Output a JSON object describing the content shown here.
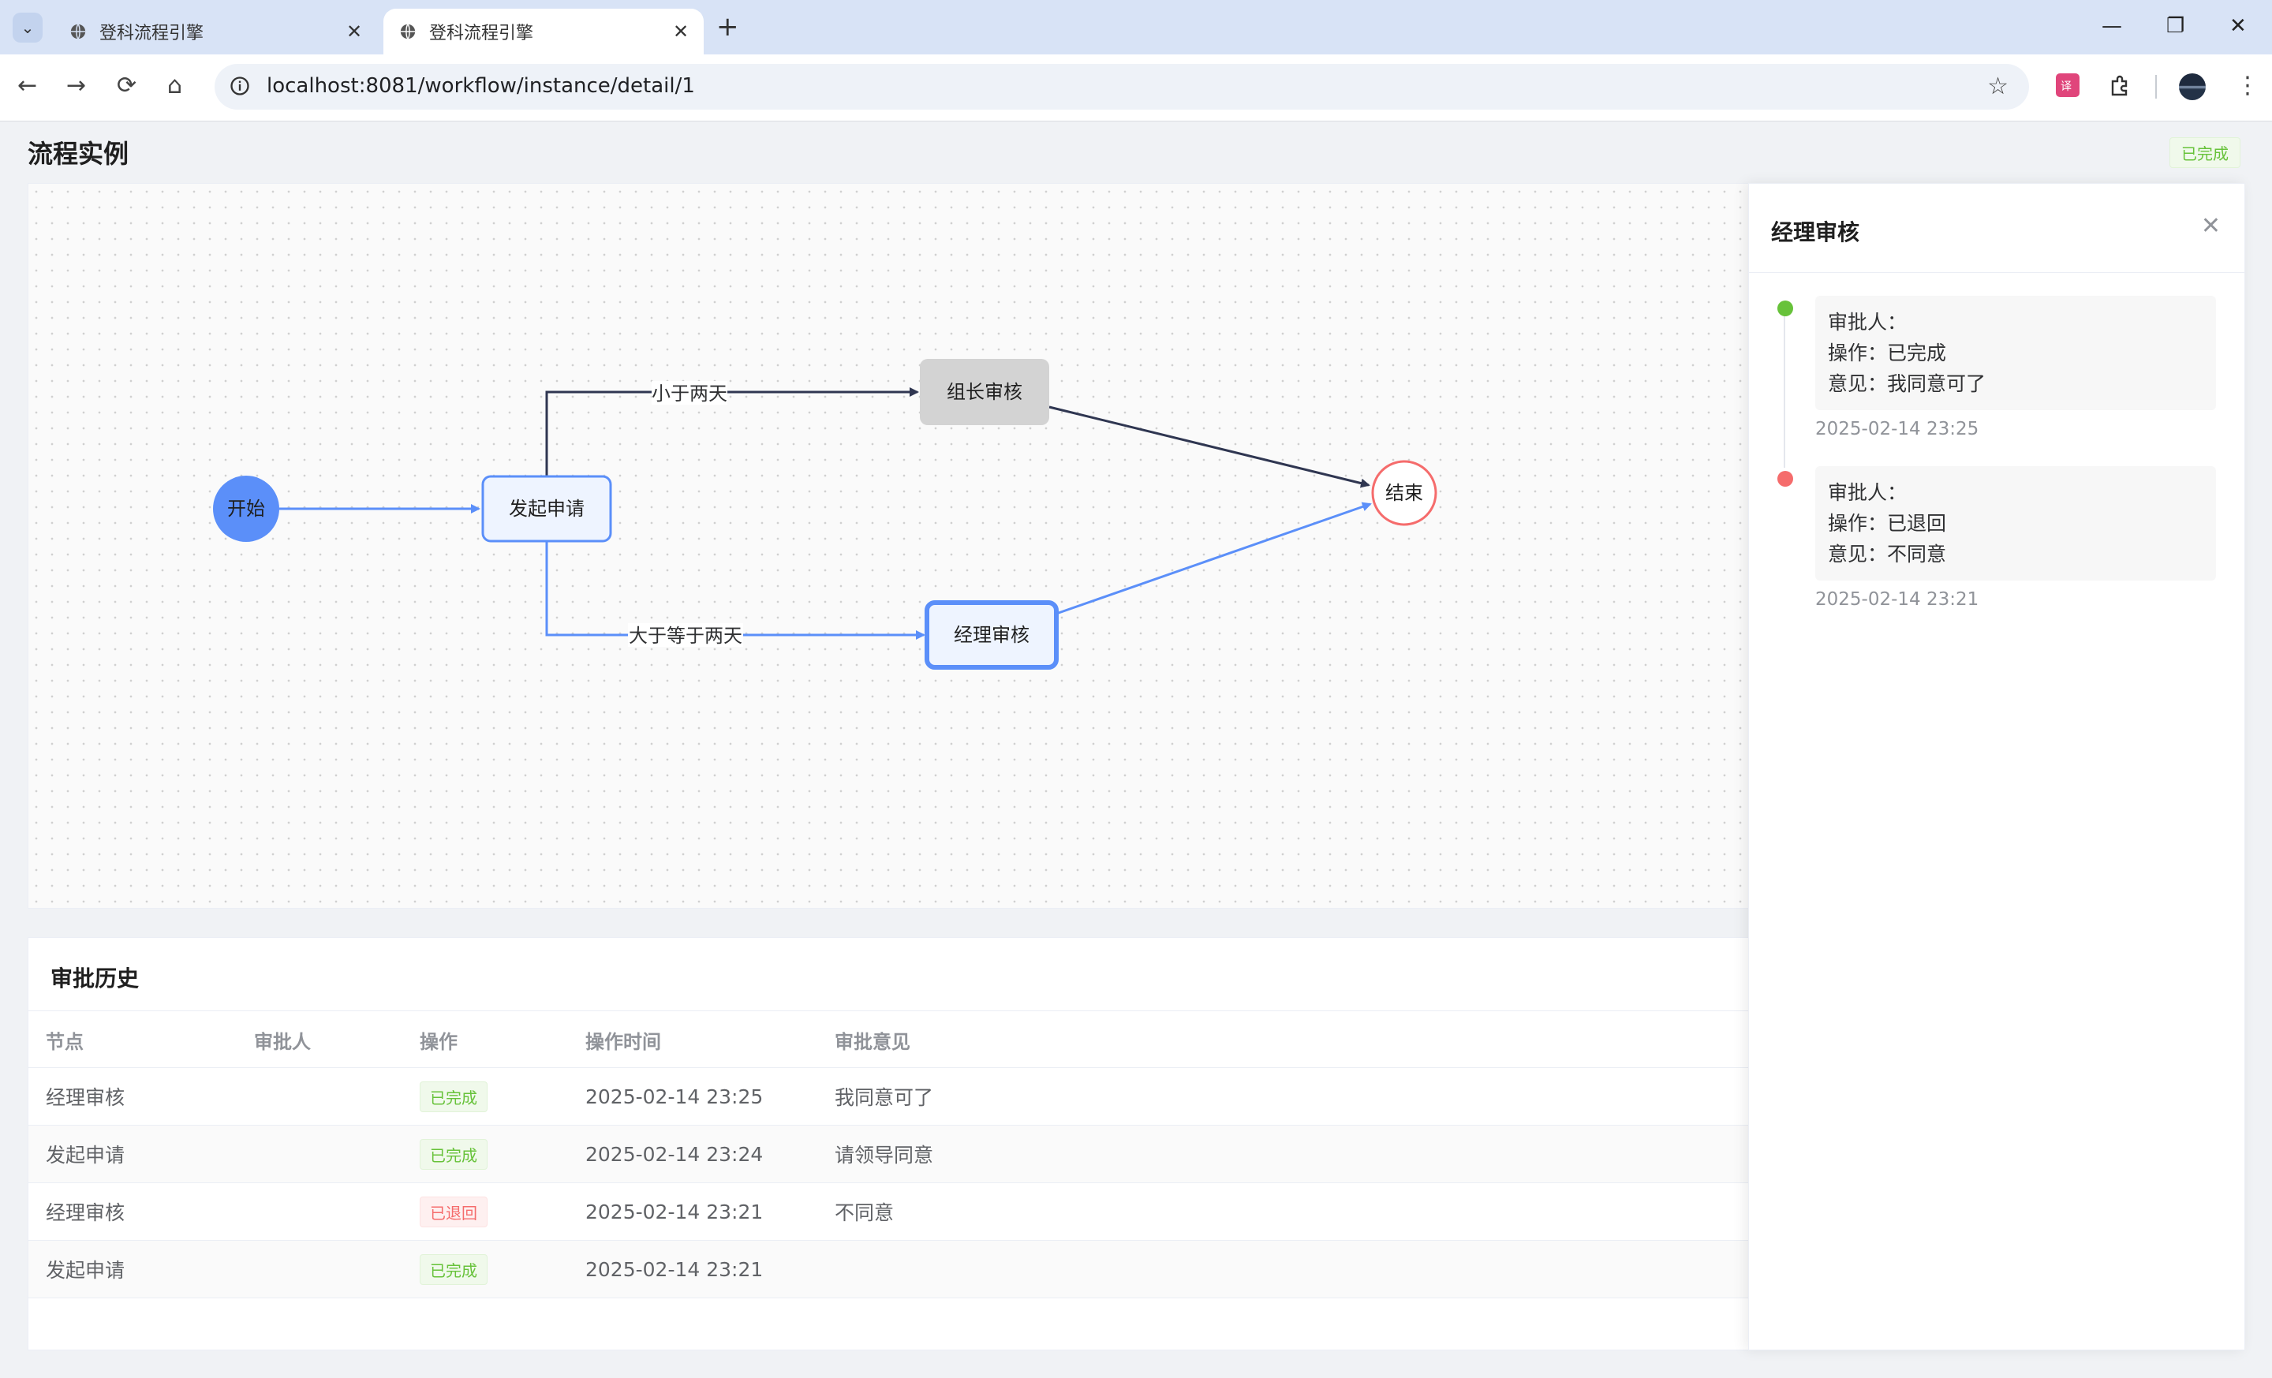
{
  "browser": {
    "tabs": [
      {
        "title": "登科流程引擎"
      },
      {
        "title": "登科流程引擎"
      }
    ],
    "url": "localhost:8081/workflow/instance/detail/1"
  },
  "page": {
    "title": "流程实例",
    "status": "已完成"
  },
  "flow": {
    "nodes": {
      "start": "开始",
      "apply": "发起申请",
      "leader": "组长审核",
      "manager": "经理审核",
      "end": "结束"
    },
    "edges": {
      "less_than_two_days": "小于两天",
      "at_least_two_days": "大于等于两天"
    }
  },
  "history": {
    "title": "审批历史",
    "columns": [
      "节点",
      "审批人",
      "操作",
      "操作时间",
      "审批意见"
    ],
    "rows": [
      {
        "node": "经理审核",
        "approver": "",
        "action": "已完成",
        "time": "2025-02-14 23:25",
        "comment": "我同意可了"
      },
      {
        "node": "发起申请",
        "approver": "",
        "action": "已完成",
        "time": "2025-02-14 23:24",
        "comment": "请领导同意"
      },
      {
        "node": "经理审核",
        "approver": "",
        "action": "已退回",
        "time": "2025-02-14 23:21",
        "comment": "不同意"
      },
      {
        "node": "发起申请",
        "approver": "",
        "action": "已完成",
        "time": "2025-02-14 23:21",
        "comment": ""
      }
    ]
  },
  "drawer": {
    "title": "经理审核",
    "entries": [
      {
        "approver": "审批人：",
        "action": "操作：已完成",
        "comment": "意见：我同意可了",
        "time": "2025-02-14 23:25",
        "dot_color": "#67c23a"
      },
      {
        "approver": "审批人：",
        "action": "操作：已退回",
        "comment": "意见：不同意",
        "time": "2025-02-14 23:21",
        "dot_color": "#f56c6c"
      }
    ]
  }
}
